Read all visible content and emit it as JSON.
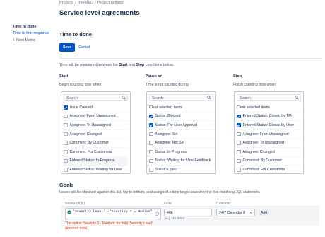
{
  "breadcrumb": [
    "Projects",
    "RiteMED",
    "Project settings"
  ],
  "page_title": "Service level agreements",
  "sidebar": {
    "section_title": "Time to done",
    "link": "Time to first response",
    "new_metric_label": "New Metric"
  },
  "metric": {
    "title": "Time to done",
    "save_label": "Save",
    "cancel_label": "Cancel"
  },
  "intro": {
    "pre": "Time will be measured between the ",
    "start": "Start",
    "mid": " and ",
    "stop": "Stop",
    "post": " conditions below."
  },
  "conditions": {
    "start": {
      "title": "Start",
      "desc": "Begin counting time when",
      "search_placeholder": "Search",
      "items": [
        {
          "label": "Issue Created",
          "checked": true
        },
        {
          "label": "Assignee: From Unassigned",
          "checked": false
        },
        {
          "label": "Assignee: To Unassigned",
          "checked": false
        },
        {
          "label": "Assignee: Changed",
          "checked": false
        },
        {
          "label": "Comment: By Customer",
          "checked": false
        },
        {
          "label": "Comment: For Customers",
          "checked": false
        },
        {
          "label": "Entered Status: In-Progress",
          "checked": false,
          "highlight": true
        },
        {
          "label": "Entered Status: Waiting for User",
          "checked": false
        }
      ]
    },
    "pause": {
      "title": "Pause on",
      "desc": "Time is not counted during",
      "search_placeholder": "Search",
      "clear_label": "Clear selected items",
      "items": [
        {
          "label": "Status: Blocked",
          "checked": true
        },
        {
          "label": "Status: For User Approval",
          "checked": true
        },
        {
          "label": "Assignee: Set",
          "checked": false
        },
        {
          "label": "Assignee: Not Set",
          "checked": false
        },
        {
          "label": "Status: In-Progress",
          "checked": false
        },
        {
          "label": "Status: Waiting for User Feedback",
          "checked": false
        },
        {
          "label": "Status: Open",
          "checked": false
        }
      ]
    },
    "stop": {
      "title": "Stop",
      "desc": "Finish counting time when",
      "search_placeholder": "Search",
      "clear_label": "Clear selected items",
      "items": [
        {
          "label": "Entered Status: Closed by TM",
          "checked": true
        },
        {
          "label": "Entered Status: Closed by User",
          "checked": true
        },
        {
          "label": "Assignee: From Unassigned",
          "checked": false
        },
        {
          "label": "Assignee: To Unassigned",
          "checked": false
        },
        {
          "label": "Assignee: Changed",
          "checked": false
        },
        {
          "label": "Comment: By Customer",
          "checked": false
        },
        {
          "label": "Comment: For Customers",
          "checked": false
        }
      ]
    }
  },
  "goals": {
    "title": "Goals",
    "desc": "Issues will be checked against this list, top to bottom, and assigned a time target based on the first matching JQL statement.",
    "col_issues": "Issues (JQL)",
    "col_goal": "Goal",
    "col_calendar": "Calendar",
    "jql_value": "'Severity Level' =\"Severity 3 - Medium\"",
    "goal_value": "40h",
    "goal_hint": "(e.g. 4h 30m)",
    "calendar_value": "24/7 Calendar (I",
    "add_label": "Add",
    "error": "The option 'Severity 3 - Medium' for field 'Severity Level' does not exist."
  },
  "colors": {
    "accent": "#0052cc",
    "error": "#de350b",
    "success": "#00875a"
  }
}
